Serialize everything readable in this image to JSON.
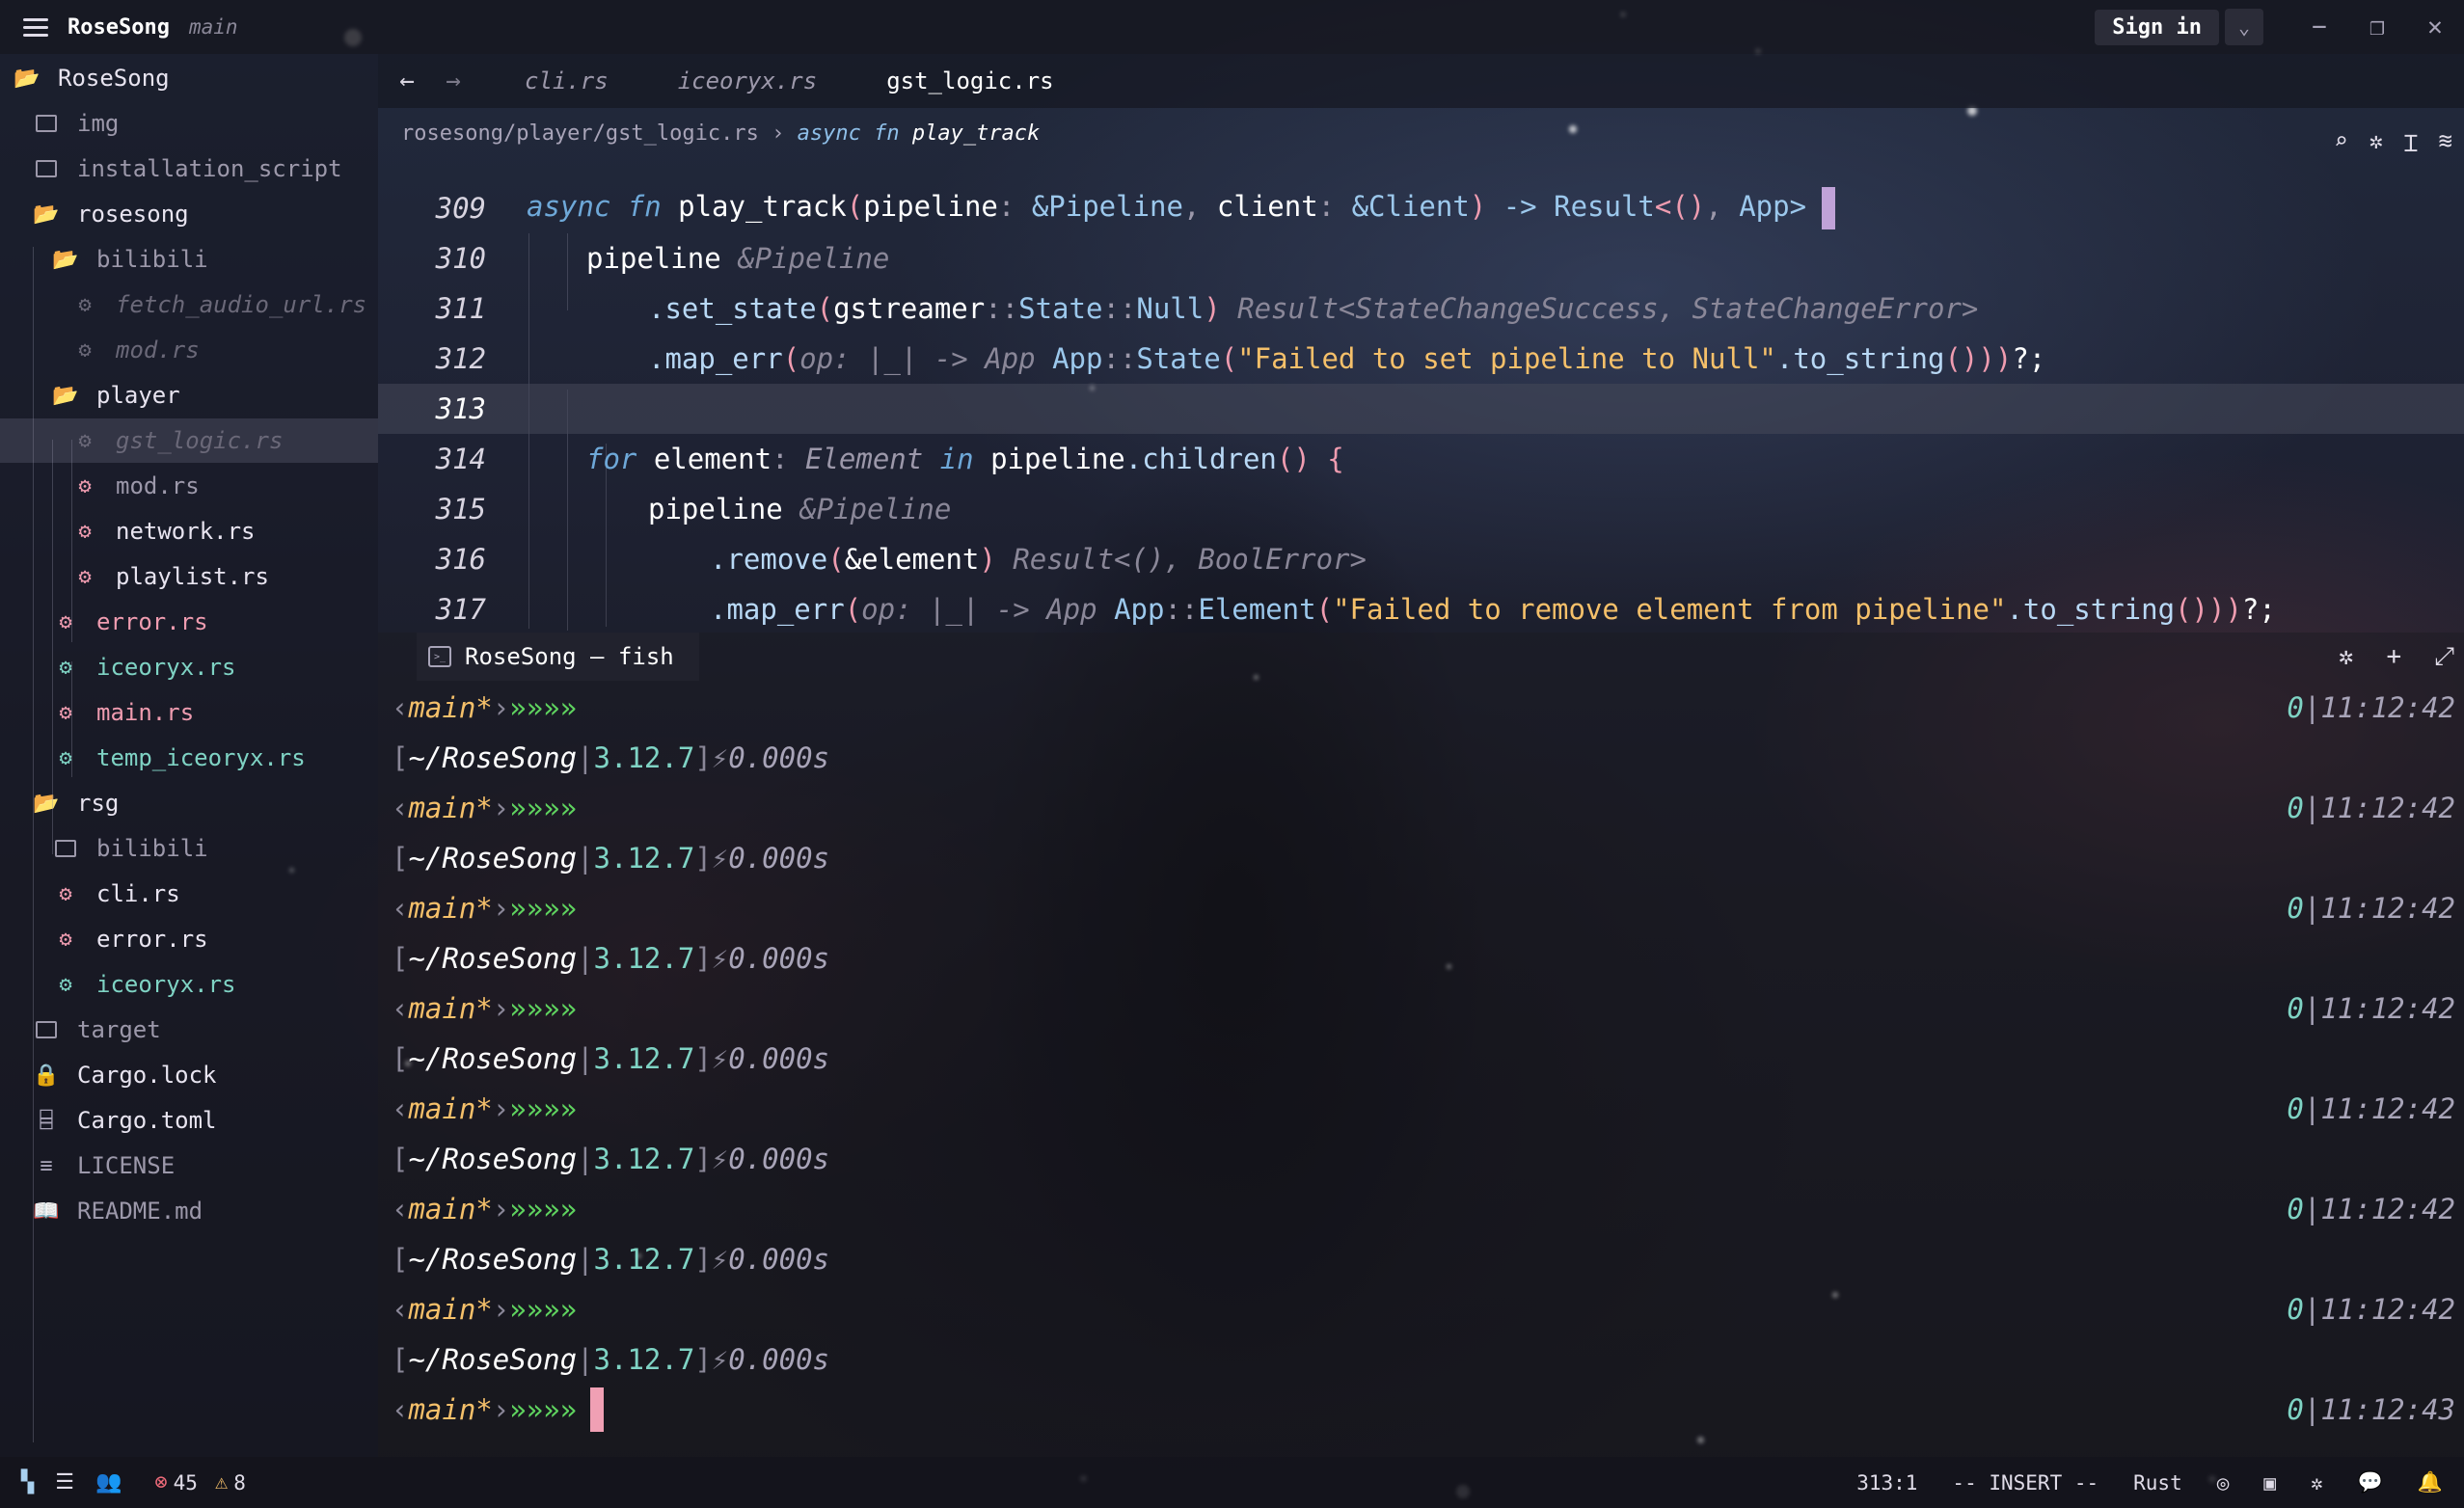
{
  "titlebar": {
    "project": "RoseSong",
    "branch": "main",
    "sign_in": "Sign in"
  },
  "sidebar": {
    "items": [
      {
        "label": "RoseSong",
        "kind": "folder-open",
        "color": "white"
      },
      {
        "label": "img",
        "kind": "folder",
        "color": "dim"
      },
      {
        "label": "installation_script",
        "kind": "folder",
        "color": "dim"
      },
      {
        "label": "rosesong",
        "kind": "folder-open",
        "color": "white"
      },
      {
        "label": "bilibili",
        "kind": "folder-open",
        "color": "dim"
      },
      {
        "label": "fetch_audio_url.rs",
        "kind": "rust",
        "color": "faded"
      },
      {
        "label": "mod.rs",
        "kind": "rust",
        "color": "faded"
      },
      {
        "label": "player",
        "kind": "folder-open",
        "color": "white"
      },
      {
        "label": "gst_logic.rs",
        "kind": "rust",
        "color": "faded"
      },
      {
        "label": "mod.rs",
        "kind": "rust",
        "color": "dim"
      },
      {
        "label": "network.rs",
        "kind": "rust",
        "color": "white"
      },
      {
        "label": "playlist.rs",
        "kind": "rust",
        "color": "white"
      },
      {
        "label": "error.rs",
        "kind": "rust",
        "color": "rose"
      },
      {
        "label": "iceoryx.rs",
        "kind": "rust",
        "color": "teal"
      },
      {
        "label": "main.rs",
        "kind": "rust",
        "color": "rose"
      },
      {
        "label": "temp_iceoryx.rs",
        "kind": "rust",
        "color": "teal"
      },
      {
        "label": "rsg",
        "kind": "folder-open",
        "color": "white"
      },
      {
        "label": "bilibili",
        "kind": "folder",
        "color": "dim"
      },
      {
        "label": "cli.rs",
        "kind": "rust",
        "color": "white"
      },
      {
        "label": "error.rs",
        "kind": "rust",
        "color": "white"
      },
      {
        "label": "iceoryx.rs",
        "kind": "rust",
        "color": "teal"
      },
      {
        "label": "target",
        "kind": "folder",
        "color": "dim"
      },
      {
        "label": "Cargo.lock",
        "kind": "lock",
        "color": "white"
      },
      {
        "label": "Cargo.toml",
        "kind": "toml",
        "color": "white"
      },
      {
        "label": "LICENSE",
        "kind": "text",
        "color": "dim"
      },
      {
        "label": "README.md",
        "kind": "book",
        "color": "dim"
      }
    ]
  },
  "editor": {
    "tabs": [
      "cli.rs",
      "iceoryx.rs",
      "gst_logic.rs"
    ],
    "breadcrumb_path": "rosesong/player/gst_logic.rs",
    "breadcrumb_sep": "›",
    "breadcrumb_kw": "async fn",
    "breadcrumb_fn": "play_track",
    "line_numbers": [
      "309",
      "310",
      "311",
      "312",
      "313",
      "314",
      "315",
      "316",
      "317"
    ],
    "lines": {
      "l309": {
        "a": "async fn ",
        "b": "play_track",
        "c": "(",
        "d": "pipeline",
        "e": ": ",
        "f": "&Pipeline",
        "g": ", ",
        "h": "client",
        "i": ": ",
        "j": "&Client",
        "k": ") ",
        "l": "-> ",
        "m": "Result",
        "n": "<",
        "o": "()",
        "p": ", ",
        "q": "App",
        "r": ">"
      },
      "l310": {
        "a": "pipeline ",
        "b": "&Pipeline"
      },
      "l311": {
        "a": ".set_state",
        "b": "(",
        "c": "gstreamer",
        "d": "::",
        "e": "State",
        "f": "::",
        "g": "Null",
        "h": ") ",
        "i": "Result<StateChangeSuccess, StateChangeError>"
      },
      "l312": {
        "a": ".map_err",
        "b": "(",
        "c": "op: |_| -> App ",
        "d": "App",
        "e": "::",
        "f": "State",
        "g": "(",
        "h": "\"Failed to set pipeline to Null\"",
        "i": ".to_string",
        "j": "()))",
        "k": "?;"
      },
      "l314": {
        "a": "for ",
        "b": "element",
        "c": ": ",
        "d": "Element ",
        "e": "in ",
        "f": "pipeline",
        ".g": "",
        "g": ".children",
        "h": "() ",
        "i": "{"
      },
      "l315": {
        "a": "pipeline ",
        "b": "&Pipeline"
      },
      "l316": {
        "a": ".remove",
        "b": "(",
        "c": "&element",
        "d": ") ",
        "e": "Result<(), BoolError>"
      },
      "l317": {
        "a": ".map_err",
        "b": "(",
        "c": "op: |_| -> App ",
        "d": "App",
        "e": "::",
        "f": "Element",
        "g": "(",
        "h": "\"Failed to remove element from pipeline\"",
        "i": ".to_string",
        "j": "()))",
        "k": "?;"
      }
    }
  },
  "terminal": {
    "tab_label": "RoseSong — fish",
    "prompt": {
      "lt": "‹",
      "branch": "main*",
      "gt": "›",
      "arrows": "»»»»"
    },
    "path_line": {
      "lb": "[",
      "path": "~/RoseSong",
      "sep": "|",
      "version": "3.12.7",
      "rb": "]",
      "bolt": "⚡",
      "duration": "0.000s"
    },
    "status": {
      "code": "0",
      "sep": "|"
    },
    "times": [
      "11:12:42",
      "11:12:42",
      "11:12:42",
      "11:12:42",
      "11:12:42",
      "11:12:42",
      "11:12:42",
      "11:12:43"
    ]
  },
  "statusbar": {
    "errors": "45",
    "warnings": "8",
    "position": "313:1",
    "mode": "-- INSERT --",
    "language": "Rust"
  }
}
